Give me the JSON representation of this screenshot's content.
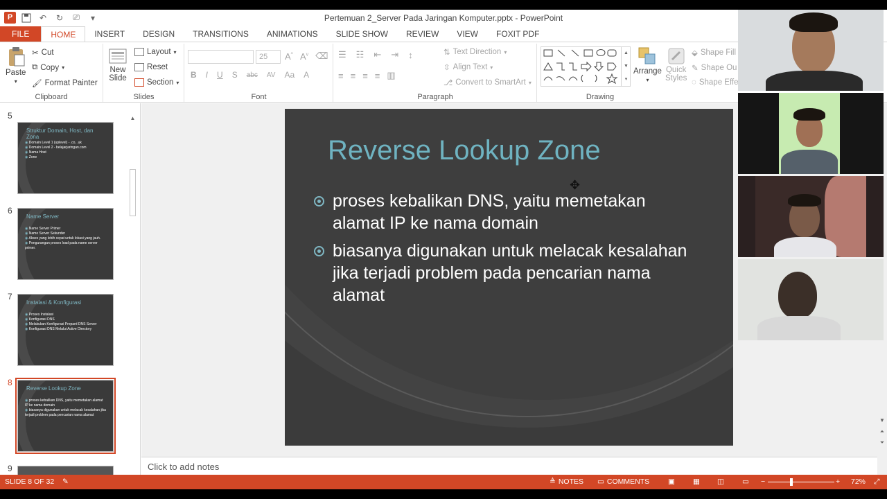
{
  "window": {
    "title": "Pertemuan 2_Server Pada Jaringan Komputer.pptx - PowerPoint"
  },
  "tabs": [
    {
      "label": "FILE"
    },
    {
      "label": "HOME"
    },
    {
      "label": "INSERT"
    },
    {
      "label": "DESIGN"
    },
    {
      "label": "TRANSITIONS"
    },
    {
      "label": "ANIMATIONS"
    },
    {
      "label": "SLIDE SHOW"
    },
    {
      "label": "REVIEW"
    },
    {
      "label": "VIEW"
    },
    {
      "label": "FOXIT PDF"
    }
  ],
  "ribbon": {
    "clipboard": {
      "paste": "Paste",
      "cut": "Cut",
      "copy": "Copy",
      "format_painter": "Format Painter",
      "label": "Clipboard"
    },
    "slides": {
      "new_slide_1": "New",
      "new_slide_2": "Slide",
      "layout": "Layout",
      "reset": "Reset",
      "section": "Section",
      "label": "Slides"
    },
    "font": {
      "size": "25",
      "label": "Font"
    },
    "paragraph": {
      "text_direction": "Text Direction",
      "align_text": "Align Text",
      "convert_smartart": "Convert to SmartArt",
      "label": "Paragraph"
    },
    "drawing": {
      "arrange": "Arrange",
      "quick_styles_1": "Quick",
      "quick_styles_2": "Styles",
      "shape_fill": "Shape Fill",
      "shape_outline": "Shape Ou",
      "shape_effects": "Shape Effe",
      "label": "Drawing"
    }
  },
  "thumbnails": [
    {
      "num": "5",
      "title": "Struktur Domain, Host, dan Zona",
      "lines": [
        "Domain Level 1 (upleveI) - .co, .uk",
        "Domain Level 2 - belajarjaringan.com",
        "Nama Host",
        "Zone"
      ]
    },
    {
      "num": "6",
      "title": "Name Server",
      "lines": [
        "Name Server Primer",
        "Name Server Sekunder",
        "Akses yang lebih cepat untuk lokasi yang jauh.",
        "Pengurangan proses load pada name server primer."
      ]
    },
    {
      "num": "7",
      "title": "Instalasi & Konfigurasi",
      "lines": [
        "Proses Instalasi",
        "Konfigurasi DNS",
        "Melakukan Konfigurasi Prepard DNS Server",
        "Konfigurasi DNS Melalui Active Directory"
      ]
    },
    {
      "num": "8",
      "title": "Reverse Lookup Zone",
      "lines": [
        "proses kebalikan DNS, yaitu memetakan alamat IP ke nama domain",
        "biasanya digunakan untuk melacak kesalahan jika terjadi problem pada pencarian nama alamat"
      ]
    },
    {
      "num": "9",
      "title": "",
      "lines": []
    }
  ],
  "slide": {
    "title": "Reverse Lookup Zone",
    "bullets": [
      "proses kebalikan DNS, yaitu memetakan alamat IP ke nama domain",
      "biasanya digunakan untuk melacak kesalahan jika terjadi problem pada pencarian nama alamat"
    ]
  },
  "notes": {
    "placeholder": "Click to add notes"
  },
  "status": {
    "slide_counter": "SLIDE 8 OF 32",
    "notes": "NOTES",
    "comments": "COMMENTS",
    "zoom": "72%"
  },
  "colors": {
    "accent": "#d24726",
    "slide_bg": "#3b3b3b",
    "slide_title": "#6fb3c1"
  }
}
